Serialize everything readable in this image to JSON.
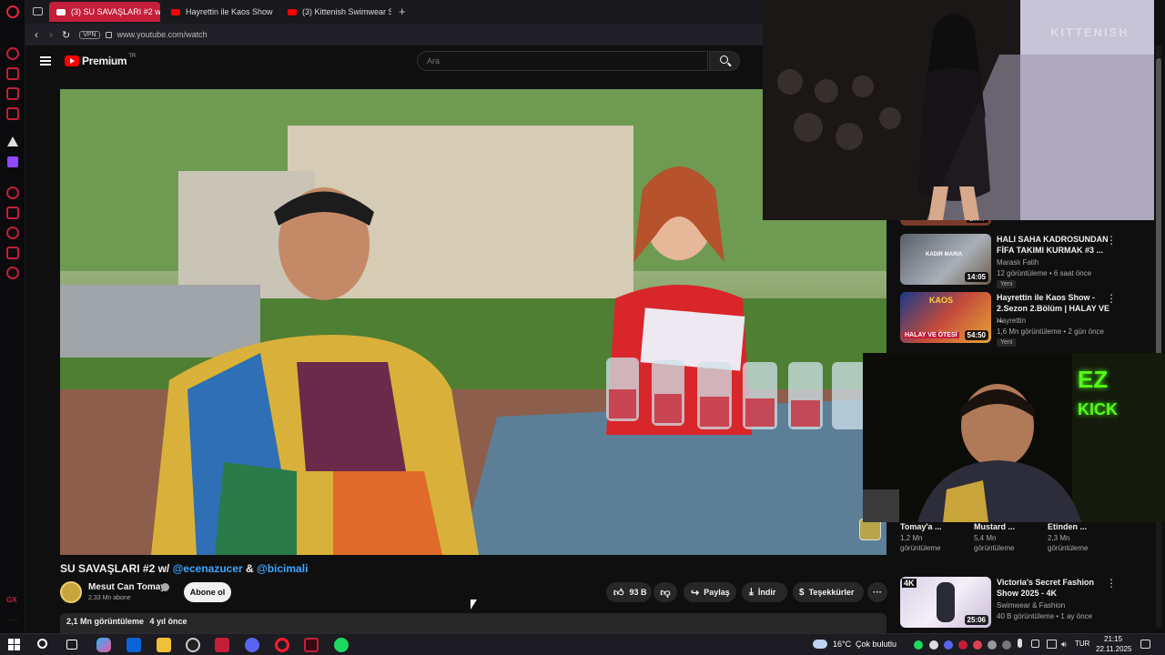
{
  "browser": {
    "tabs": [
      {
        "label": "(3) SU SAVAŞLARI #2 w/"
      },
      {
        "label": "Hayrettin ile Kaos Show -"
      },
      {
        "label": "(3) Kittenish Swimwear S"
      }
    ],
    "new_tab_symbol": "+",
    "vpn_label": "VPN",
    "url": "www.youtube.com/watch",
    "sidebar_bottom_label": "GX"
  },
  "youtube": {
    "logo_text": "Premium",
    "logo_sup": "TR",
    "search_placeholder": "Ara"
  },
  "video": {
    "title_plain": "SU SAVAŞLARI #2 w/ ",
    "mention_1": "@ecenazucer",
    "title_amp": " & ",
    "mention_2": "@bicimali",
    "channel_name": "Mesut Can Tomay",
    "subscribers": "2,33 Mn abone",
    "subscribe_label": "Abone ol",
    "likes": "93 B",
    "share_label": "Paylaş",
    "download_label": "İndir",
    "thanks_label": "Teşekkürler",
    "more_label": "···",
    "views": "2,1 Mn görüntüleme",
    "age": "4 yıl önce"
  },
  "recommendations": [
    {
      "title": "HALI SAHA KADROSUNDAN FİFA TAKIMI KURMAK #3 ...",
      "channel": "Maraslı Fatih",
      "meta": "12 görüntüleme • 6 saat önce",
      "badge": "Yeni",
      "duration": "14:05",
      "thumb_text": "KADIR MARIA"
    },
    {
      "title": "Hayrettin ile Kaos Show - 2.Sezon 2.Bölüm | HALAY VE ...",
      "channel": "Hayrettin",
      "meta": "1,6 Mn görüntüleme • 2 gün önce",
      "badge": "Yeni",
      "duration": "54:50",
      "thumb_text": "HALAY VE ÖTESİ",
      "thumb_text_2": "KAOS"
    },
    {
      "title": "Victoria's Secret Fashion Show 2025 - 4K",
      "channel": "Swimwear & Fashion",
      "meta": "40 B görüntüleme • 1 ay önce",
      "duration": "25:06",
      "thumb_text": "4K"
    }
  ],
  "partial_card_duration": "27:47",
  "shorts_row": [
    {
      "title": "Tomay'a ...",
      "views": "1,2 Mn",
      "unit": "görüntüleme"
    },
    {
      "title": "Mustard ...",
      "views": "5,4 Mn",
      "unit": "görüntüleme"
    },
    {
      "title": "Etinden ...",
      "views": "2,3 Mn",
      "unit": "görüntüleme"
    }
  ],
  "overlays": {
    "runway_backdrop_text": "KITTENISH",
    "facecam_neon_1": "EZ",
    "facecam_neon_2": "KICK"
  },
  "taskbar": {
    "temperature": "16°C",
    "weather": "Çok bulutlu",
    "language": "TUR",
    "time": "21:15",
    "date": "22.11.2025"
  },
  "colors": {
    "opera_red": "#c41e3a",
    "youtube_red": "#ff0000",
    "mention_blue": "#3ea6ff"
  }
}
